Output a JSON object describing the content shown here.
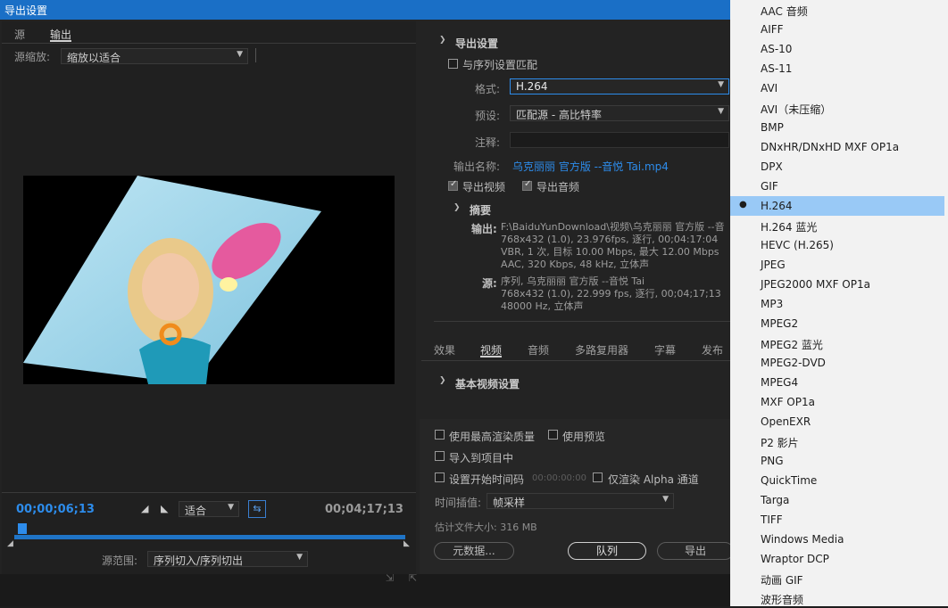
{
  "title": "导出设置",
  "left": {
    "tab_source": "源",
    "tab_output": "输出",
    "scale_label": "源缩放:",
    "scale_value": "缩放以适合",
    "timecode_current": "00;00;06;13",
    "timecode_end": "00;04;17;13",
    "fit_value": "适合",
    "range_label": "源范围:",
    "range_value": "序列切入/序列切出"
  },
  "export": {
    "section_title": "导出设置",
    "match_sequence": "与序列设置匹配",
    "format_label": "格式:",
    "format_value": "H.264",
    "preset_label": "预设:",
    "preset_value": "匹配源 - 高比特率",
    "comment_label": "注释:",
    "output_name_label": "输出名称:",
    "output_name_value": "乌克丽丽 官方版 --音悦 Tai.mp4",
    "export_video": "导出视频",
    "export_audio": "导出音频",
    "summary_title": "摘要",
    "output_label": "输出:",
    "output_lines": [
      "F:\\BaiduYunDownload\\视频\\乌克丽丽 官方版 --音",
      "768x432 (1.0), 23.976fps, 逐行, 00;04:17:04",
      "VBR, 1 次, 目标 10.00 Mbps, 最大 12.00 Mbps",
      "AAC, 320 Kbps, 48 kHz, 立体声"
    ],
    "source_label": "源:",
    "source_lines": [
      "序列, 乌克丽丽 官方版 --音悦 Tai",
      "768x432 (1.0), 22.999 fps, 逐行, 00;04;17;13",
      "48000 Hz, 立体声"
    ]
  },
  "tabs": [
    "效果",
    "视频",
    "音频",
    "多路复用器",
    "字幕",
    "发布"
  ],
  "video_section": "基本视频设置",
  "bottom": {
    "max_render": "使用最高渲染质量",
    "use_preview": "使用预览",
    "import_project": "导入到项目中",
    "set_start_tc": "设置开始时间码",
    "start_tc_value": "00:00:00:00",
    "render_alpha": "仅渲染 Alpha 通道",
    "interp_label": "时间插值:",
    "interp_value": "帧采样",
    "filesize": "估计文件大小: 316 MB",
    "metadata_btn": "元数据...",
    "queue_btn": "队列",
    "export_btn": "导出"
  },
  "menu": [
    "AAC 音频",
    "AIFF",
    "AS-10",
    "AS-11",
    "AVI",
    "AVI（未压缩）",
    "BMP",
    "DNxHR/DNxHD MXF OP1a",
    "DPX",
    "GIF",
    "H.264",
    "H.264 蓝光",
    "HEVC (H.265)",
    "JPEG",
    "JPEG2000 MXF OP1a",
    "MP3",
    "MPEG2",
    "MPEG2 蓝光",
    "MPEG2-DVD",
    "MPEG4",
    "MXF OP1a",
    "OpenEXR",
    "P2 影片",
    "PNG",
    "QuickTime",
    "Targa",
    "TIFF",
    "Windows Media",
    "Wraptor DCP",
    "动画 GIF",
    "波形音频"
  ],
  "menu_selected": "H.264"
}
